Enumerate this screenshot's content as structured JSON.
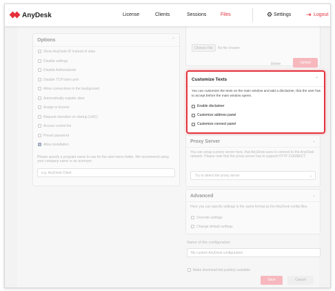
{
  "app": {
    "logo_text": "AnyDesk",
    "brand_color": "#e5303b"
  },
  "nav": {
    "license": "License",
    "clients": "Clients",
    "sessions": "Sessions",
    "files": "Files",
    "settings": "Settings",
    "logout": "Logout",
    "active": "Files"
  },
  "left_panel": {
    "title": "Options",
    "options": [
      "Show AnyDesk-ID instead of alias",
      "Disable settings",
      "Disable Addressbook",
      "Disable TCP listen port",
      "Allow connections in the background",
      "Automatically register alias",
      "Assign to license",
      "Request elevation on startup (UAC)",
      "Access control list",
      "Preset password",
      "Allow installation"
    ],
    "checked_index": 10,
    "note": "Please specify a program name to use for the start menu folder. We recommend using your company name or an acronym.",
    "input_value": "e.g. AnyDesk Client"
  },
  "right_top": {
    "file_button": "Choose File",
    "file_status": "No file chosen",
    "delete_label": "Delete",
    "upload_label": "Upload"
  },
  "customize": {
    "title": "Customize Texts",
    "description": "You can customize the texts on the main window and add a disclaimer, that the user has to accept before the main window opens.",
    "options": [
      "Enable disclaimer",
      "Customize address panel",
      "Customize connect panel"
    ]
  },
  "proxy": {
    "title": "Proxy Server",
    "description": "You can setup a proxy server here, that AnyDesk uses to connect to the AnyDesk network. Please note that the proxy server has to support HTTP CONNECT.",
    "select_value": "Try to detect the proxy server"
  },
  "advanced": {
    "title": "Advanced",
    "description": "Here you can specify settings in the same format as the AnyDesk config files.",
    "options": [
      "Override settings",
      "Change default settings"
    ]
  },
  "config": {
    "label": "Name of the configuration",
    "input_value": "My custom AnyDesk configuration",
    "save_checkbox": "Make download link publicly available",
    "save_label": "Save",
    "cancel_label": "Cancel"
  }
}
